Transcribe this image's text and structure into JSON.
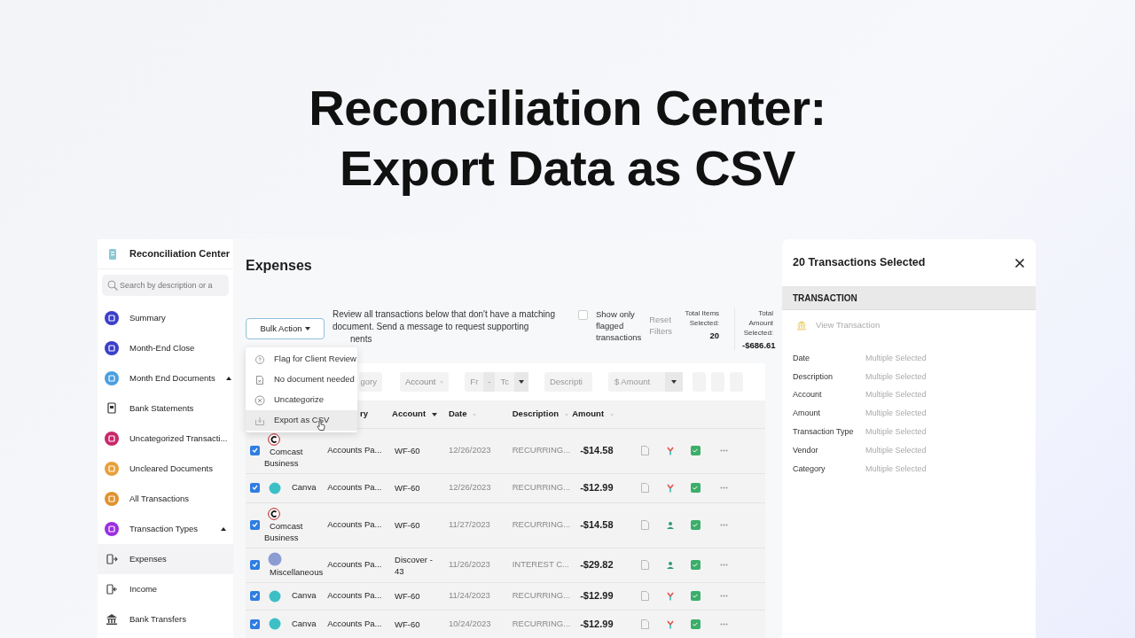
{
  "headline": [
    "Reconciliation Center:",
    "Export Data as CSV"
  ],
  "sidebar": {
    "title": "Reconciliation Center",
    "search": {
      "placeholder": "Search by description or a"
    },
    "items": [
      {
        "label": "Summary",
        "kind": "circle",
        "color": "#3b3fc9",
        "selected": false
      },
      {
        "label": "Month-End Close",
        "kind": "circle",
        "color": "#3b3fc9",
        "selected": false
      },
      {
        "label": "Month End Documents",
        "kind": "circle",
        "color": "#4a9fe0",
        "expanded": true,
        "selected": false
      },
      {
        "label": "Bank Statements",
        "kind": "statement",
        "selected": false
      },
      {
        "label": "Uncategorized Transacti...",
        "kind": "circle",
        "color": "#c8286a",
        "selected": false
      },
      {
        "label": "Uncleared Documents",
        "kind": "circle",
        "color": "#e8a03a",
        "selected": false
      },
      {
        "label": "All Transactions",
        "kind": "circle",
        "color": "#e0922f",
        "selected": false
      },
      {
        "label": "Transaction Types",
        "kind": "circle",
        "color": "#9b2fe0",
        "expanded": true,
        "selected": false
      },
      {
        "label": "Expenses",
        "kind": "out",
        "selected": true
      },
      {
        "label": "Income",
        "kind": "in",
        "selected": false
      },
      {
        "label": "Bank Transfers",
        "kind": "bank",
        "selected": false
      }
    ]
  },
  "main": {
    "title": "Expenses",
    "bulk_button": "Bulk Action",
    "menu": [
      {
        "label": "Flag for Client Review",
        "kind": "question",
        "hovered": false
      },
      {
        "label": "No document needed",
        "kind": "nodoc",
        "hovered": false
      },
      {
        "label": "Uncategorize",
        "kind": "cross",
        "hovered": false
      },
      {
        "label": "Export as CSV",
        "kind": "export",
        "hovered": true
      }
    ],
    "description": "Review all transactions below that don't have a matching document. Send a message to request supporting",
    "description_tail": "nents",
    "flagged": {
      "label": "Show only flagged transactions",
      "checked": false
    },
    "reset": "Reset Filters",
    "totals": [
      {
        "label": "Total Items Selected:",
        "value": "20"
      },
      {
        "label": "Total Amount Selected:",
        "value": "-$686.61"
      }
    ],
    "filters": [
      {
        "kind": "field",
        "placeholder": "gory"
      },
      {
        "kind": "select",
        "label": "Account"
      },
      {
        "kind": "range",
        "from": "Fr",
        "sep": "-",
        "to": "Tc"
      },
      {
        "kind": "field",
        "placeholder": "Descripti"
      },
      {
        "kind": "amount",
        "placeholder": "$ Amount"
      },
      {
        "kind": "blank"
      },
      {
        "kind": "blank"
      },
      {
        "kind": "blank"
      }
    ],
    "columns": [
      {
        "label": "ry",
        "sortable": false
      },
      {
        "label": "Account",
        "sortable": true,
        "sorted": true
      },
      {
        "label": "Date",
        "sortable": true,
        "sorted": false
      },
      {
        "label": "Description",
        "sortable": true,
        "sorted": false
      },
      {
        "label": "Amount",
        "sortable": true,
        "sorted": false
      }
    ],
    "rows": [
      {
        "selected": true,
        "vendor": {
          "name": "Comcast Business",
          "kind": "comcast"
        },
        "category": "Accounts Pa...",
        "account": "WF-60",
        "date": "12/26/2023",
        "description": "RECURRING...",
        "amount": "-$14.58",
        "type_icon": {
          "kind": "split"
        },
        "reconciled": true
      },
      {
        "selected": true,
        "vendor": {
          "name": "Canva",
          "kind": "canva"
        },
        "category": "Accounts Pa...",
        "account": "WF-60",
        "date": "12/26/2023",
        "description": "RECURRING...",
        "amount": "-$12.99",
        "type_icon": {
          "kind": "split"
        },
        "reconciled": true
      },
      {
        "selected": true,
        "vendor": {
          "name": "Comcast Business",
          "kind": "comcast"
        },
        "category": "Accounts Pa...",
        "account": "WF-60",
        "date": "11/27/2023",
        "description": "RECURRING...",
        "amount": "-$14.58",
        "type_icon": {
          "kind": "person"
        },
        "reconciled": true
      },
      {
        "selected": true,
        "vendor": {
          "name": "Miscellaneous",
          "kind": "misc"
        },
        "category": "Accounts Pa...",
        "account": "Discover - 43",
        "date": "11/26/2023",
        "description": "INTEREST C...",
        "amount": "-$29.82",
        "type_icon": {
          "kind": "person"
        },
        "reconciled": true
      },
      {
        "selected": true,
        "vendor": {
          "name": "Canva",
          "kind": "canva"
        },
        "category": "Accounts Pa...",
        "account": "WF-60",
        "date": "11/24/2023",
        "description": "RECURRING...",
        "amount": "-$12.99",
        "type_icon": {
          "kind": "split"
        },
        "reconciled": true
      },
      {
        "selected": true,
        "vendor": {
          "name": "Canva",
          "kind": "canva"
        },
        "category": "Accounts Pa...",
        "account": "WF-60",
        "date": "10/24/2023",
        "description": "RECURRING...",
        "amount": "-$12.99",
        "type_icon": {
          "kind": "split"
        },
        "reconciled": true
      }
    ]
  },
  "panel": {
    "title": "20 Transactions Selected",
    "section": "TRANSACTION",
    "link": "View Transaction",
    "fields": [
      {
        "label": "Date",
        "value": "Multiple Selected"
      },
      {
        "label": "Description",
        "value": "Multiple Selected"
      },
      {
        "label": "Account",
        "value": "Multiple Selected"
      },
      {
        "label": "Amount",
        "value": "Multiple Selected"
      },
      {
        "label": "Transaction Type",
        "value": "Multiple Selected"
      },
      {
        "label": "Vendor",
        "value": "Multiple Selected"
      },
      {
        "label": "Category",
        "value": "Multiple Selected"
      }
    ]
  }
}
